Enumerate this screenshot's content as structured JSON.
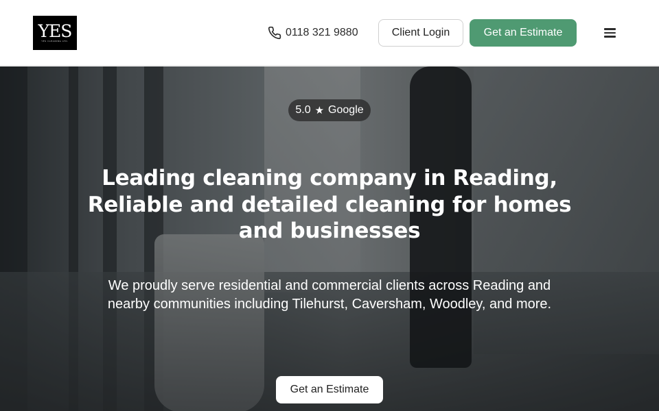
{
  "header": {
    "logo": {
      "mark": "YES",
      "subtitle": "YES CLEANING LTD."
    },
    "phone": {
      "icon": "phone-icon",
      "number": "0118 321 9880"
    },
    "login_label": "Client Login",
    "estimate_label": "Get an Estimate",
    "menu_icon": "hamburger-menu-icon"
  },
  "hero": {
    "rating": {
      "score": "5.0",
      "icon": "star-icon",
      "source": "Google"
    },
    "headline": "Leading cleaning company in Reading, Reliable and detailed cleaning for homes and businesses",
    "subtext": "We proudly serve residential and commercial clients across Reading and nearby communities including Tilehurst, Caversham, Woodley, and more.",
    "cta_label": "Get an Estimate"
  },
  "colors": {
    "accent": "#4f9a72",
    "logo_bg": "#000000",
    "text_dark": "#2b2b2b"
  }
}
